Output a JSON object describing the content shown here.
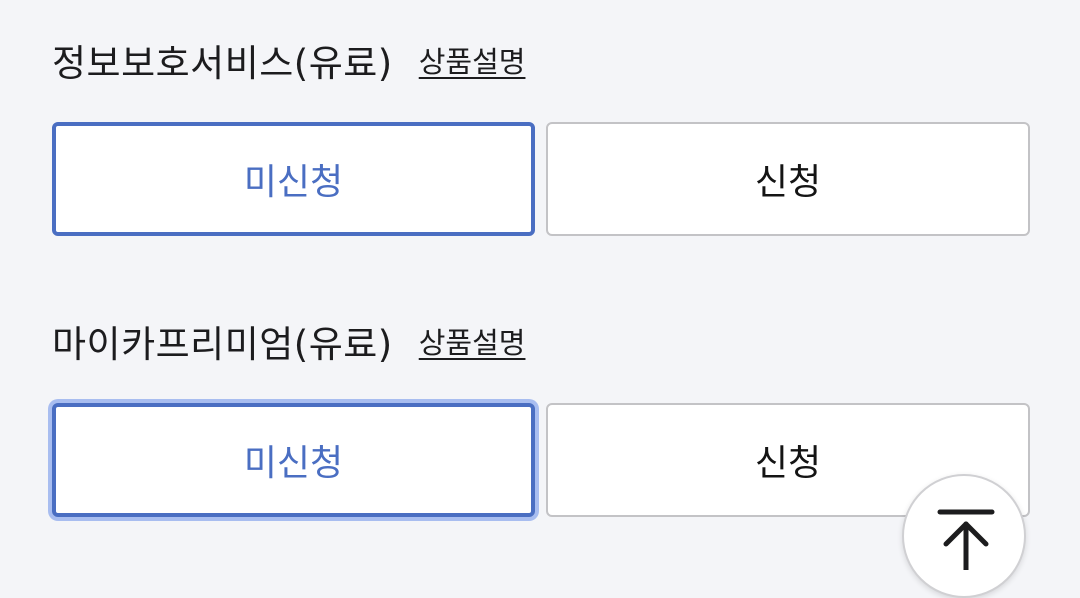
{
  "sections": [
    {
      "title": "정보보호서비스(유료)",
      "link_label": "상품설명",
      "options": {
        "left": "미신청",
        "right": "신청"
      },
      "selected": "미신청"
    },
    {
      "title": "마이카프리미엄(유료)",
      "link_label": "상품설명",
      "options": {
        "left": "미신청",
        "right": "신청"
      },
      "selected": "미신청"
    }
  ],
  "scroll_top_icon": "arrow-up-to-top-icon",
  "colors": {
    "accent": "#4a6ec2",
    "background": "#f4f5f8",
    "border": "#c3c3c6"
  }
}
